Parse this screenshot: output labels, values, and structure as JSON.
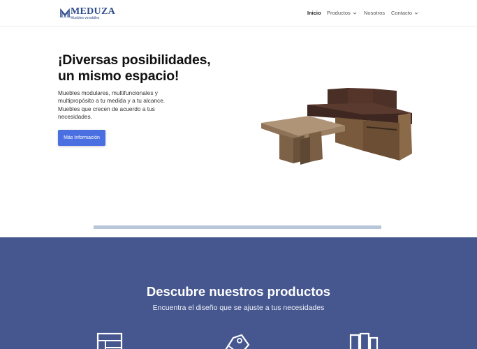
{
  "brand": {
    "name": "MEDUZA",
    "tagline": "Muebles versátiles",
    "color": "#2e4b8c"
  },
  "nav": {
    "items": [
      {
        "label": "Inicio",
        "active": true,
        "has_dropdown": false
      },
      {
        "label": "Productos",
        "active": false,
        "has_dropdown": true
      },
      {
        "label": "Nosotros",
        "active": false,
        "has_dropdown": false
      },
      {
        "label": "Contacto",
        "active": false,
        "has_dropdown": true
      }
    ]
  },
  "hero": {
    "title_line1": "¡Diversas posibilidades,",
    "title_line2": "un mismo espacio!",
    "description": "Muebles modulares, multifuncionales y multipropósito a tu medida y a tu alcance. Muebles que crecen de acuerdo a tus necesidades.",
    "button_label": "Más Información",
    "button_color": "#4a6fe0",
    "image_icon": "sofa-and-table-image"
  },
  "products_section": {
    "title": "Descubre nuestros productos",
    "subtitle": "Encuentra el diseño que se ajuste a tus necesidades",
    "background": "#46578f",
    "icons": [
      "shelf-icon",
      "tag-icon",
      "wardrobe-icon"
    ]
  }
}
